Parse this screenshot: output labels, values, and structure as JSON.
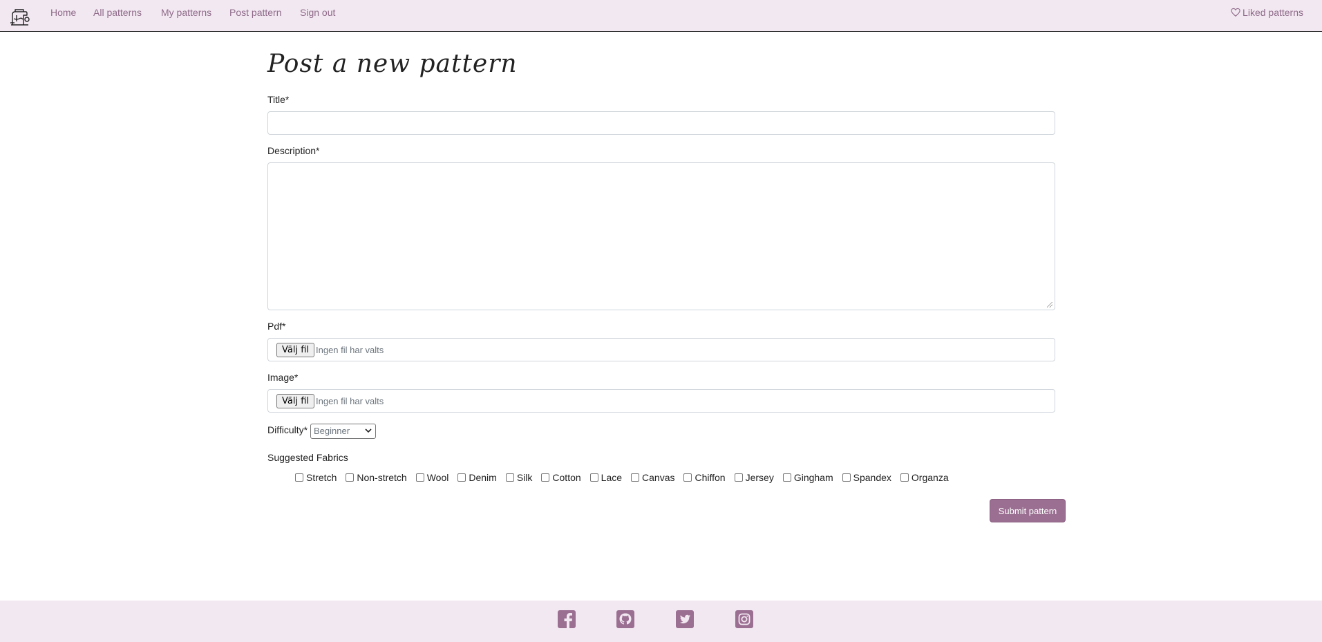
{
  "nav": {
    "links": [
      "Home",
      "All patterns",
      "My patterns",
      "Post pattern",
      "Sign out"
    ],
    "liked": "Liked patterns"
  },
  "form": {
    "heading": "Post a new pattern",
    "title_label": "Title*",
    "title_value": "",
    "description_label": "Description*",
    "description_value": "",
    "pdf_label": "Pdf*",
    "image_label": "Image*",
    "file_button": "Välj fil",
    "file_status": "Ingen fil har valts",
    "difficulty_label": "Difficulty*",
    "difficulty_value": "Beginner",
    "fabrics_label": "Suggested Fabrics",
    "fabrics": [
      "Stretch",
      "Non-stretch",
      "Wool",
      "Denim",
      "Silk",
      "Cotton",
      "Lace",
      "Canvas",
      "Chiffon",
      "Jersey",
      "Gingham",
      "Spandex",
      "Organza"
    ],
    "submit": "Submit pattern"
  },
  "footer": {
    "icons": [
      "facebook-icon",
      "github-icon",
      "twitter-icon",
      "instagram-icon"
    ]
  },
  "colors": {
    "nav_bg": "#f2e8f1",
    "accent": "#9b6f92",
    "link": "#8e6a89"
  }
}
